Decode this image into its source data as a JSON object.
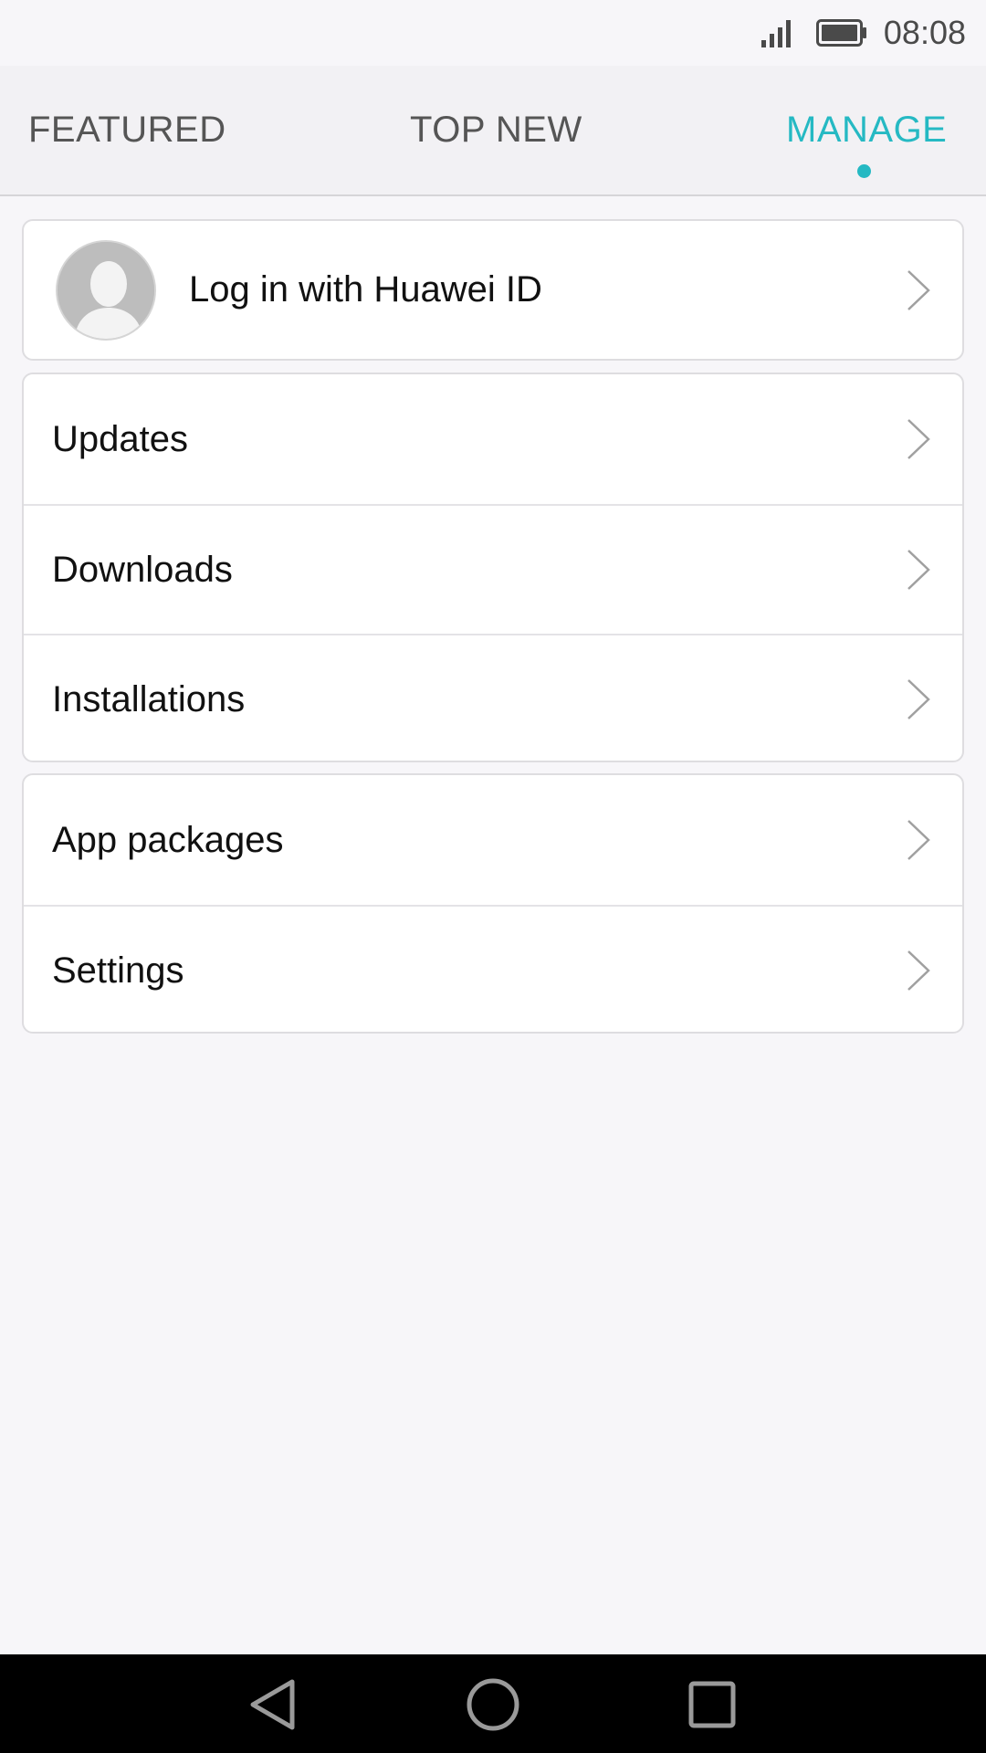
{
  "status_bar": {
    "time": "08:08",
    "signal_icon": "signal-icon",
    "battery_icon": "battery-icon"
  },
  "tabs": [
    {
      "label": "FEATURED",
      "active": false
    },
    {
      "label": "TOP NEW",
      "active": false
    },
    {
      "label": "MANAGE",
      "active": true
    }
  ],
  "accent_color": "#25b9c3",
  "login": {
    "label": "Log in with Huawei ID",
    "avatar_icon": "avatar-placeholder-icon"
  },
  "menu_group_1": [
    {
      "label": "Updates"
    },
    {
      "label": "Downloads"
    },
    {
      "label": "Installations"
    }
  ],
  "menu_group_2": [
    {
      "label": "App packages"
    },
    {
      "label": "Settings"
    }
  ],
  "nav_bar": {
    "back_icon": "back-triangle-icon",
    "home_icon": "home-circle-icon",
    "recent_icon": "recent-square-icon"
  }
}
